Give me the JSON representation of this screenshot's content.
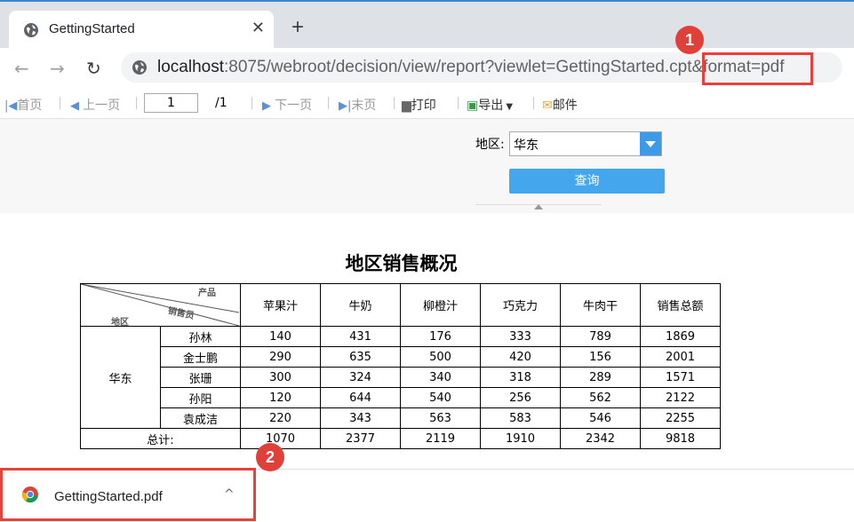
{
  "browser": {
    "tab_title": "GettingStarted",
    "tab_close": "✕",
    "new_tab": "+",
    "url_host": "localhost",
    "url_rest": ":8075/webroot/decision/view/report?viewlet=GettingStarted.cpt",
    "url_param": "&format=pdf",
    "back": "←",
    "forward": "→",
    "reload": "↻"
  },
  "report_toolbar": {
    "first": "首页",
    "prev": "上一页",
    "page_value": "1",
    "page_total": "/1",
    "next": "下一页",
    "last": "末页",
    "print": "打印",
    "export": "导出",
    "email": "邮件"
  },
  "params": {
    "region_label": "地区:",
    "region_value": "华东",
    "query_button": "查询"
  },
  "report": {
    "title": "地区销售概况",
    "corner": {
      "product": "产品",
      "salesperson": "销售员",
      "region": "地区"
    },
    "columns": [
      "苹果汁",
      "牛奶",
      "柳橙汁",
      "巧克力",
      "牛肉干",
      "销售总额"
    ],
    "region": "华东",
    "rows": [
      {
        "name": "孙林",
        "values": [
          "140",
          "431",
          "176",
          "333",
          "789",
          "1869"
        ]
      },
      {
        "name": "金士鹏",
        "values": [
          "290",
          "635",
          "500",
          "420",
          "156",
          "2001"
        ]
      },
      {
        "name": "张珊",
        "values": [
          "300",
          "324",
          "340",
          "318",
          "289",
          "1571"
        ]
      },
      {
        "name": "孙阳",
        "values": [
          "120",
          "644",
          "540",
          "256",
          "562",
          "2122"
        ]
      },
      {
        "name": "袁成洁",
        "values": [
          "220",
          "343",
          "563",
          "583",
          "546",
          "2255"
        ]
      }
    ],
    "total_label": "总计:",
    "totals": [
      "1070",
      "2377",
      "2119",
      "1910",
      "2342",
      "9818"
    ]
  },
  "annotations": {
    "badge1": "1",
    "badge2": "2"
  },
  "download": {
    "filename": "GettingStarted.pdf",
    "chevron": "^"
  }
}
